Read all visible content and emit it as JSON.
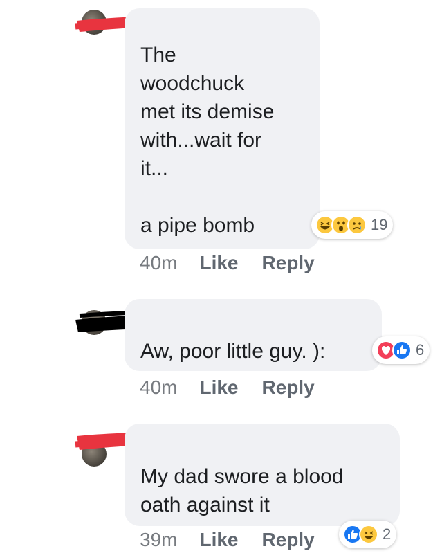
{
  "comments": [
    {
      "text": "The\nwoodchuck\nmet its demise\nwith...wait for\nit...\n\na pipe bomb",
      "time": "40m",
      "like_label": "Like",
      "reply_label": "Reply",
      "reactions": {
        "icons": [
          "haha-icon",
          "wow-icon",
          "sad-icon"
        ],
        "count": "19"
      },
      "redaction_color": "#e8343f"
    },
    {
      "text": "Aw, poor little guy. ):",
      "time": "40m",
      "like_label": "Like",
      "reply_label": "Reply",
      "reactions": {
        "icons": [
          "love-icon",
          "like-icon"
        ],
        "count": "6"
      },
      "redaction_color": "#000000"
    },
    {
      "text": "My dad swore a blood\noath against it",
      "time": "39m",
      "like_label": "Like",
      "reply_label": "Reply",
      "reactions": {
        "icons": [
          "like-icon",
          "haha-icon"
        ],
        "count": "2"
      },
      "redaction_color": "#e8343f"
    }
  ],
  "colors": {
    "bubble": "#f0f1f4",
    "text": "#1c1e21",
    "meta": "#606770",
    "like_blue": "#1877f2",
    "love_red": "#f33e58",
    "emoji_yellow": "#fcc83f"
  }
}
